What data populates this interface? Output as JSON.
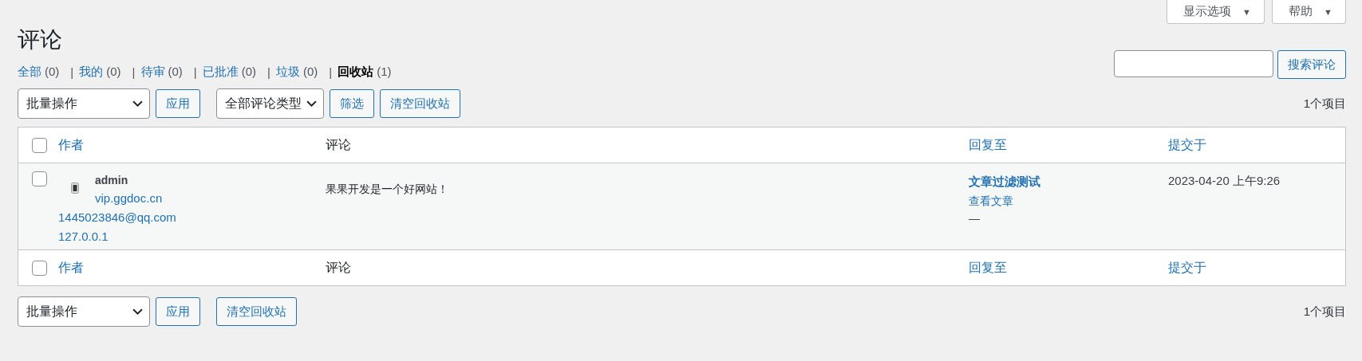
{
  "screen_tabs": [
    {
      "label": "显示选项",
      "arrow": "▼"
    },
    {
      "label": "帮助",
      "arrow": "▼"
    }
  ],
  "title": "评论",
  "separator": "|",
  "status_links": [
    {
      "label": "全部",
      "count": "(0)",
      "selected": false
    },
    {
      "label": "我的",
      "count": "(0)",
      "selected": false
    },
    {
      "label": "待审",
      "count": "(0)",
      "selected": false
    },
    {
      "label": "已批准",
      "count": "(0)",
      "selected": false
    },
    {
      "label": "垃圾",
      "count": "(0)",
      "selected": false
    },
    {
      "label": "回收站",
      "count": "(1)",
      "selected": true
    }
  ],
  "search": {
    "button": "搜索评论"
  },
  "top_toolbar": {
    "bulk_action": "批量操作",
    "apply": "应用",
    "type_filter": "全部评论类型",
    "filter": "筛选",
    "empty_trash": "清空回收站",
    "count": "1个项目"
  },
  "table": {
    "header": {
      "checked": false,
      "columns": [
        "作者",
        "评论",
        "回复至",
        "提交于"
      ]
    },
    "rows": [
      {
        "checked": false,
        "author": "admin",
        "url": "vip.ggdoc.cn",
        "email": "1445023846@qq.com",
        "ip": "127.0.0.1",
        "comment": "果果开发是一个好网站！",
        "post_title": "文章过滤测试",
        "view_post": "查看文章",
        "dash": "—",
        "date": "2023-04-20 上午9:26"
      }
    ],
    "footer": {
      "checked": false,
      "columns": [
        "作者",
        "评论",
        "回复至",
        "提交于"
      ]
    }
  },
  "bottom_toolbar": {
    "bulk_action": "批量操作",
    "apply": "应用",
    "empty_trash": "清空回收站",
    "count": "1个项目"
  }
}
